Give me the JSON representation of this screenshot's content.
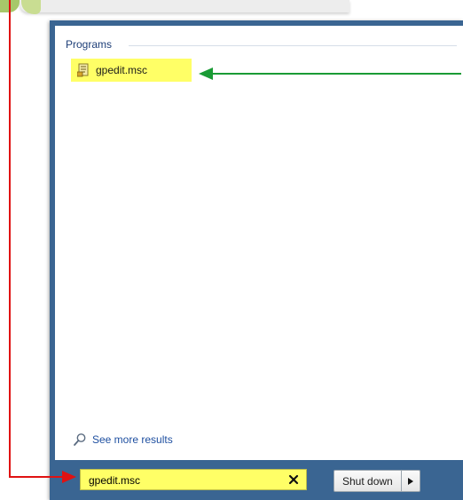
{
  "start_menu": {
    "programs_header": "Programs",
    "program_items": [
      {
        "label": "gpedit.msc",
        "icon": "msc-file-icon"
      }
    ],
    "see_more_label": "See more results",
    "search": {
      "value": "gpedit.msc",
      "clear_icon": "close-icon"
    },
    "shutdown": {
      "label": "Shut down",
      "arrow_icon": "caret-right-icon"
    }
  },
  "annotations": {
    "green_arrow_color": "#1a9b35",
    "red_arrow_color": "#e01212",
    "highlight_color": "#ffff66",
    "panel_color": "#3a6592"
  }
}
